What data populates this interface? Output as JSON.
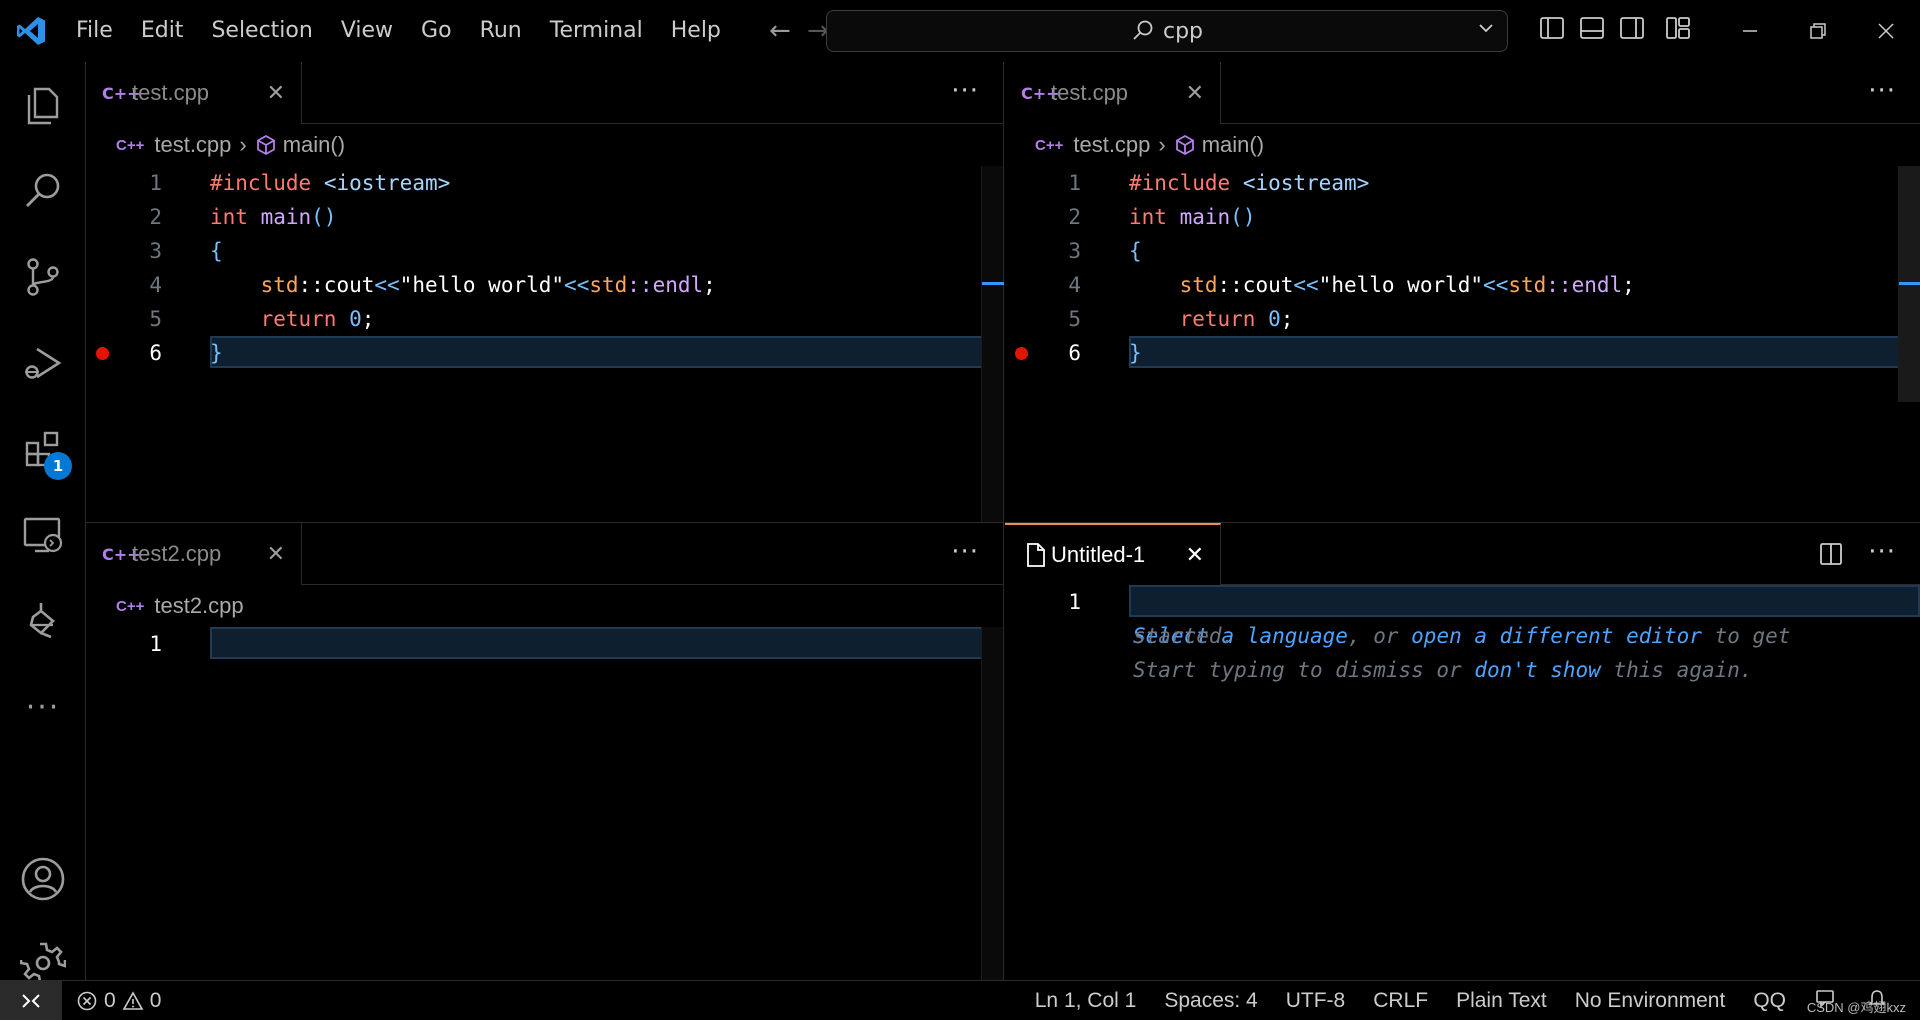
{
  "titlebar": {
    "menu": [
      "File",
      "Edit",
      "Selection",
      "View",
      "Go",
      "Run",
      "Terminal",
      "Help"
    ],
    "search_text": "cpp"
  },
  "activity": {
    "extensions_badge": "1"
  },
  "groups": {
    "top_left": {
      "tab": {
        "name": "test.cpp"
      },
      "breadcrumb": {
        "file": "test.cpp",
        "symbol": "main()"
      },
      "lines": [
        "1",
        "2",
        "3",
        "4",
        "5",
        "6"
      ]
    },
    "top_right": {
      "tab": {
        "name": "test.cpp"
      },
      "breadcrumb": {
        "file": "test.cpp",
        "symbol": "main()"
      },
      "lines": [
        "1",
        "2",
        "3",
        "4",
        "5",
        "6"
      ]
    },
    "bottom_left": {
      "tab": {
        "name": "test2.cpp"
      },
      "breadcrumb": {
        "file": "test2.cpp"
      },
      "lines": [
        "1"
      ]
    },
    "bottom_right": {
      "tab": {
        "name": "Untitled-1"
      },
      "lines": [
        "1"
      ],
      "hint": {
        "select_language": "Select a language",
        "or": ", or ",
        "open_editor": "open a different editor",
        "to_get": " to get",
        "started": "started.",
        "start_typing": "Start typing to dismiss or ",
        "dont_show": "don't show",
        "this_again": " this again."
      }
    }
  },
  "code": {
    "include": "#include",
    "header": "<iostream>",
    "int": "int",
    "main": "main",
    "parens": "()",
    "open_brace": "{",
    "std1": "std",
    "cout": "::cout",
    "shl1": "<<",
    "string": "\"hello world\"",
    "shl2": "<<",
    "std2": "std",
    "endl": "::endl",
    "semi": ";",
    "return": "return",
    "zero": "0",
    "close_brace": "}"
  },
  "statusbar": {
    "errors": "0",
    "warnings": "0",
    "position": "Ln 1, Col 1",
    "spaces": "Spaces: 4",
    "encoding": "UTF-8",
    "eol": "CRLF",
    "language": "Plain Text",
    "environment": "No Environment",
    "qq": "QQ",
    "watermark": "CSDN @鸡翅kxz"
  }
}
